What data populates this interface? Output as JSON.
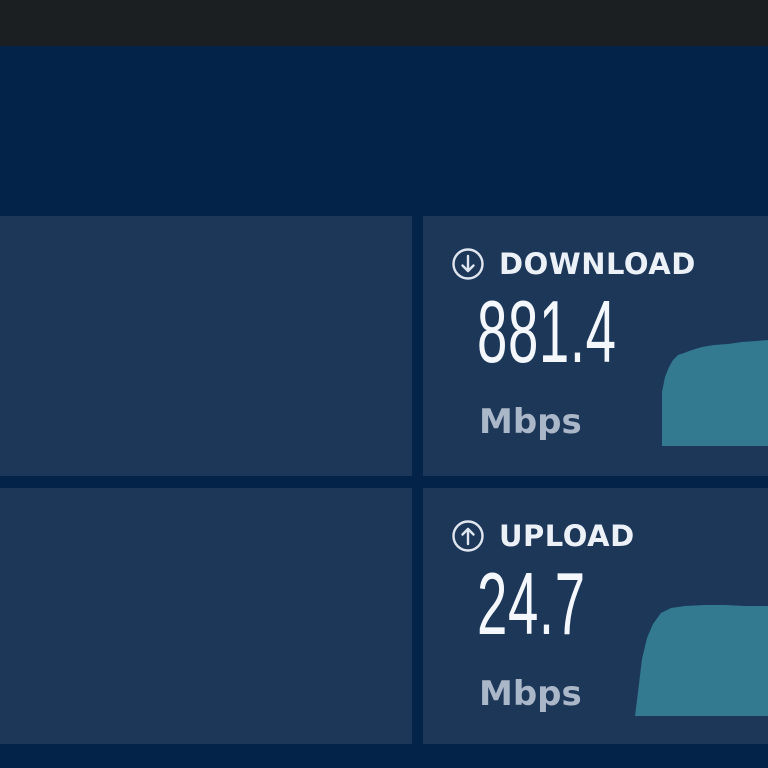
{
  "download": {
    "title": "DOWNLOAD",
    "value": "881.4",
    "unit": "Mbps",
    "icon": "arrow-down-circle-icon"
  },
  "upload": {
    "title": "UPLOAD",
    "value": "24.7",
    "unit": "Mbps",
    "icon": "arrow-up-circle-icon"
  },
  "colors": {
    "background": "#032448",
    "panel": "#1d3759",
    "topbar": "#1c1f22",
    "sparkline": "#33798f"
  }
}
